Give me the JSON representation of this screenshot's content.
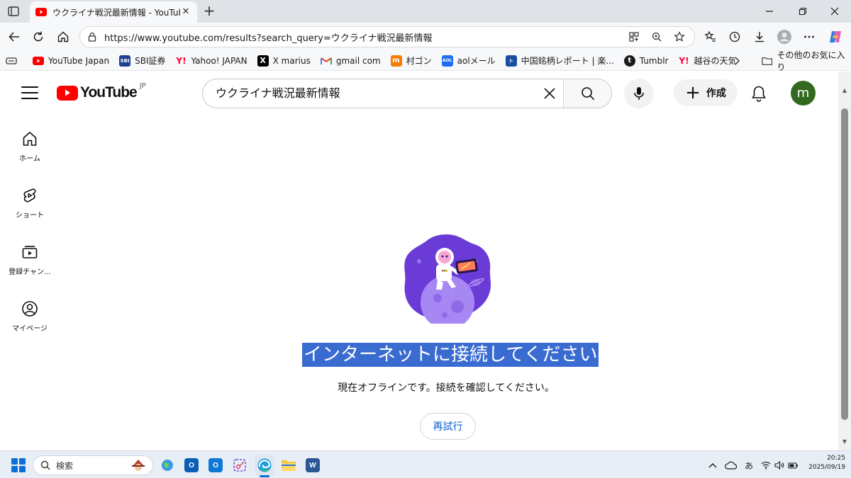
{
  "browser": {
    "tab": {
      "title": "ウクライナ戦況最新情報 - YouTube"
    },
    "address": {
      "url": "https://www.youtube.com/results?search_query=ウクライナ戦況最新情報"
    },
    "bookmarks": [
      {
        "label": "YouTube Japan",
        "icon": "youtube-icon",
        "color": "#ff0000"
      },
      {
        "label": "SBI証券",
        "icon": "sbi-icon",
        "color": "#1f3f8f"
      },
      {
        "label": "Yahoo! JAPAN",
        "icon": "yahoo-icon",
        "color": "#ff0033"
      },
      {
        "label": "X marius",
        "icon": "x-icon",
        "color": "#000000"
      },
      {
        "label": "gmail com",
        "icon": "gmail-icon",
        "color": "#ea4335"
      },
      {
        "label": "村ゴン",
        "icon": "m-icon",
        "color": "#f57c00"
      },
      {
        "label": "aolメール",
        "icon": "aol-icon",
        "color": "#1b6df1"
      },
      {
        "label": "中国銘柄レポート | 楽...",
        "icon": "rakuten-icon",
        "color": "#1b4ea3"
      },
      {
        "label": "Tumblr",
        "icon": "tumblr-icon",
        "color": "#1a1a1a"
      },
      {
        "label": "越谷の天気",
        "icon": "yahoo-icon",
        "color": "#ff0033"
      }
    ],
    "other_favorites": "その他のお気に入り"
  },
  "youtube": {
    "logo_text": "YouTube",
    "country_code": "JP",
    "search_query": "ウクライナ戦況最新情報",
    "create_label": "作成",
    "avatar_letter": "m",
    "avatar_color": "#33691e",
    "guide": [
      {
        "label": "ホーム",
        "icon": "home-icon"
      },
      {
        "label": "ショート",
        "icon": "shorts-icon"
      },
      {
        "label": "登録チャン...",
        "icon": "subscriptions-icon"
      },
      {
        "label": "マイページ",
        "icon": "account-icon"
      }
    ],
    "offline": {
      "title": "インターネットに接続してください",
      "message": "現在オフラインです。接続を確認してください。",
      "retry_label": "再試行"
    }
  },
  "taskbar": {
    "search_label": "検索",
    "ime_indicator": "あ",
    "time": "20:25",
    "date": "2025/09/19"
  }
}
